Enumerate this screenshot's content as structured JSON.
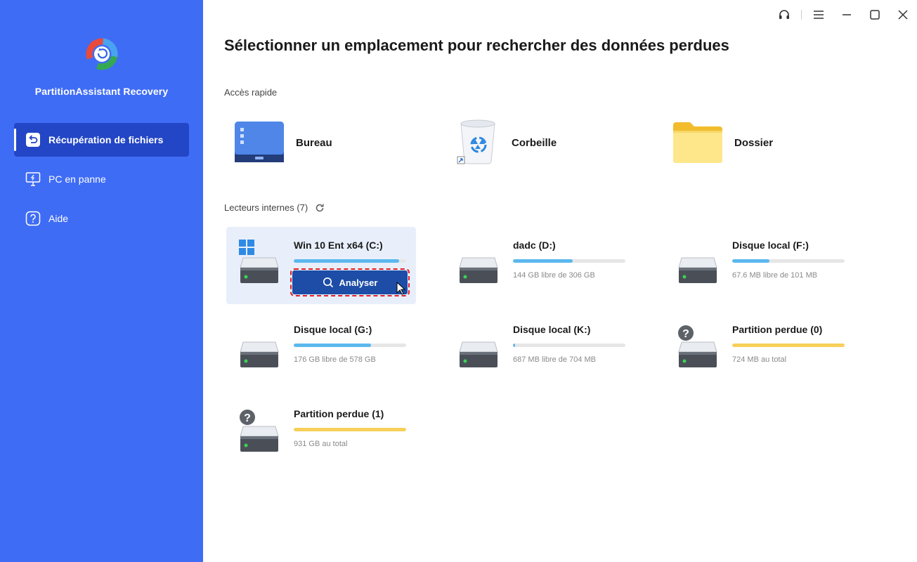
{
  "app": {
    "name": "PartitionAssistant Recovery"
  },
  "sidebar": {
    "items": [
      {
        "label": "Récupération de fichiers",
        "icon": "recovery-icon",
        "active": true
      },
      {
        "label": "PC en panne",
        "icon": "monitor-icon",
        "active": false
      },
      {
        "label": "Aide",
        "icon": "help-icon",
        "active": false
      }
    ]
  },
  "window_controls": [
    "headset-icon",
    "menu-icon",
    "minimize-icon",
    "maximize-icon",
    "close-icon"
  ],
  "main": {
    "title": "Sélectionner un emplacement pour rechercher des données perdues",
    "quick_access": {
      "label": "Accès rapide",
      "items": [
        {
          "label": "Bureau",
          "icon": "desktop-icon"
        },
        {
          "label": "Corbeille",
          "icon": "recycle-bin-icon"
        },
        {
          "label": "Dossier",
          "icon": "folder-icon"
        }
      ]
    },
    "drives": {
      "label": "Lecteurs internes (7)",
      "items": [
        {
          "name": "Win 10 Ent x64 (C:)",
          "info": "",
          "used_fraction": 0.94,
          "bar_color": "#5bb8ee",
          "type": "system",
          "scan_label": "Analyser"
        },
        {
          "name": "dadc (D:)",
          "info": "144 GB libre de 306 GB",
          "used_fraction": 0.53,
          "bar_color": "#5bb8ee",
          "type": "disk"
        },
        {
          "name": "Disque local (F:)",
          "info": "67.6 MB libre de 101 MB",
          "used_fraction": 0.33,
          "bar_color": "#5bb8ee",
          "type": "disk"
        },
        {
          "name": "Disque local (G:)",
          "info": "176 GB libre de 578 GB",
          "used_fraction": 0.69,
          "bar_color": "#5bb8ee",
          "type": "disk"
        },
        {
          "name": "Disque local (K:)",
          "info": "687 MB libre de 704 MB",
          "used_fraction": 0.02,
          "bar_color": "#5bb8ee",
          "type": "disk"
        },
        {
          "name": "Partition perdue (0)",
          "info": "724 MB au total",
          "used_fraction": 1.0,
          "bar_color": "#f7cf5a",
          "type": "lost"
        },
        {
          "name": "Partition perdue (1)",
          "info": "931 GB au total",
          "used_fraction": 1.0,
          "bar_color": "#f7cf5a",
          "type": "lost"
        }
      ]
    }
  }
}
